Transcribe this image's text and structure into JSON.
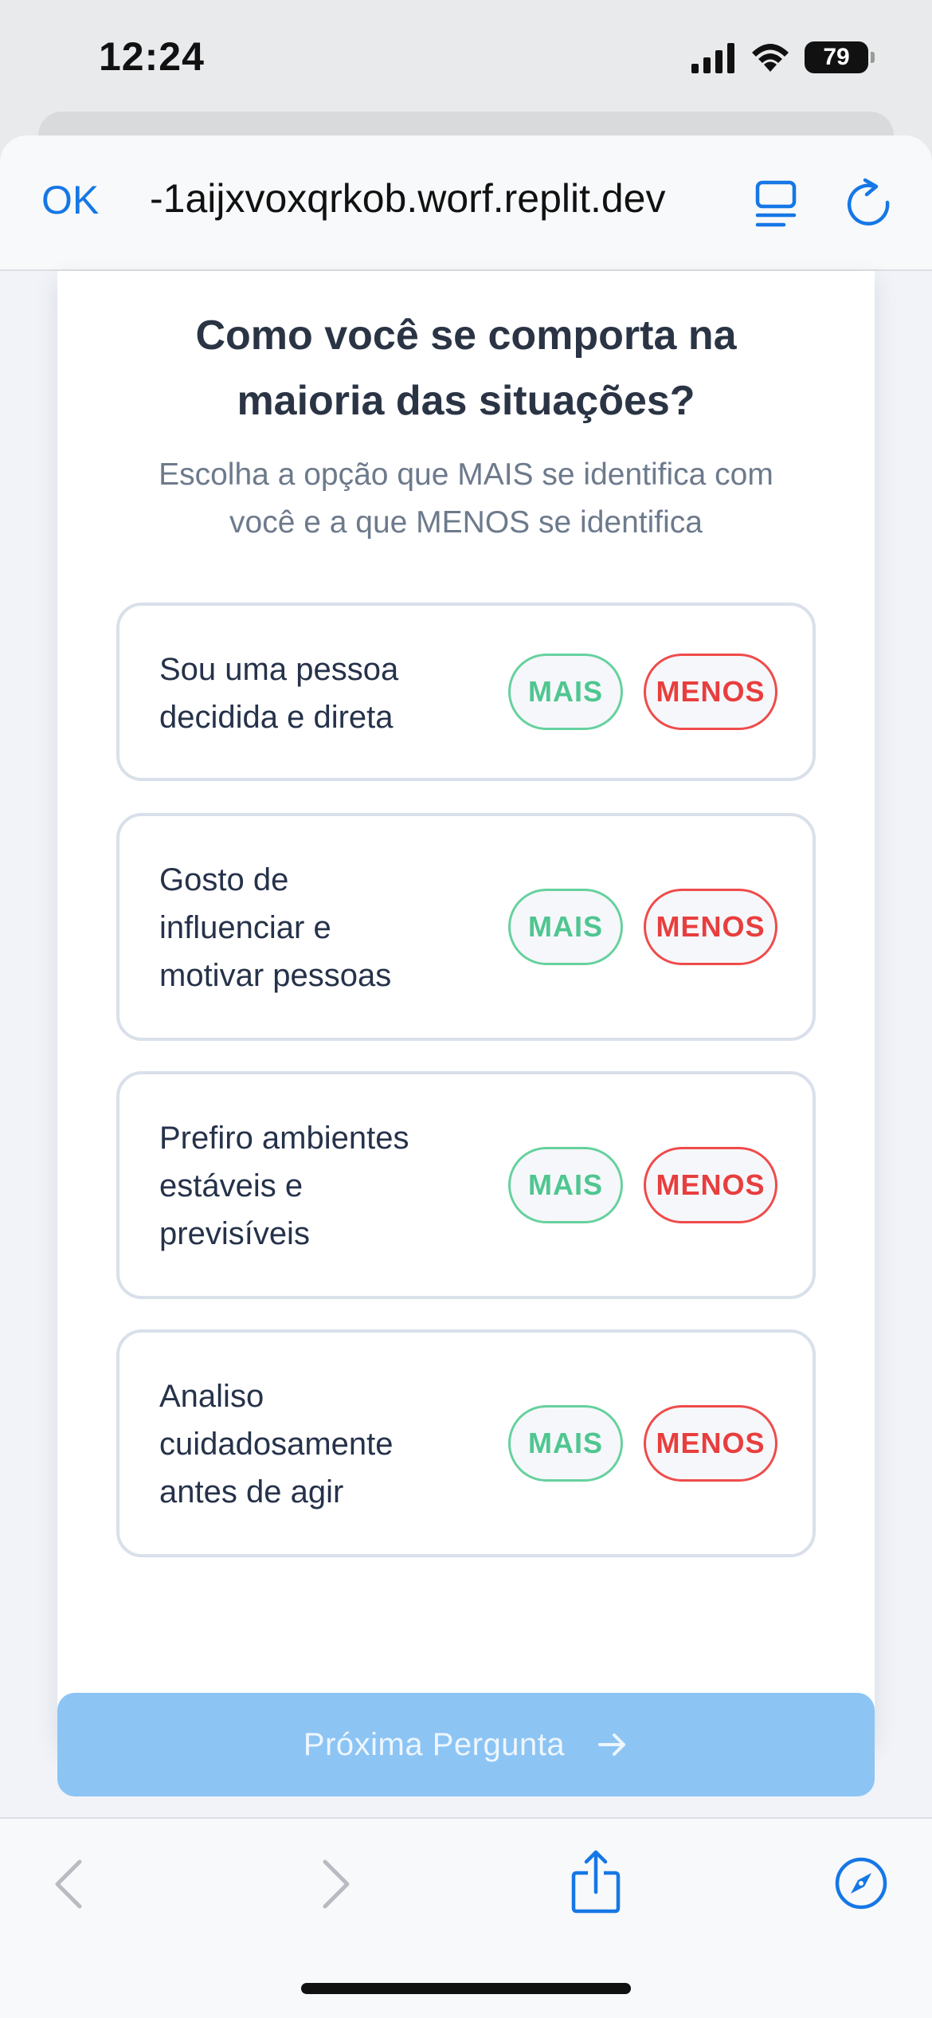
{
  "status_bar": {
    "time": "12:24",
    "battery": "79",
    "icons": [
      "signal-icon",
      "wifi-icon",
      "battery-icon"
    ]
  },
  "browser": {
    "done_label": "OK",
    "url": "-1aijxvoxqrkob.worf.replit.dev",
    "icons": [
      "reader-icon",
      "reload-icon"
    ]
  },
  "question": {
    "title_line1": "Como você se comporta na",
    "title_line2": "maioria das situações?",
    "subtitle_line1": "Escolha a opção que MAIS se identifica com",
    "subtitle_line2": "você e a que MENOS se identifica"
  },
  "options": [
    {
      "lines": [
        "Sou uma pessoa",
        "decidida e direta"
      ],
      "more_label": "MAIS",
      "less_label": "MENOS"
    },
    {
      "lines": [
        "Gosto de",
        "influenciar e",
        "motivar pessoas"
      ],
      "more_label": "MAIS",
      "less_label": "MENOS"
    },
    {
      "lines": [
        "Prefiro ambientes",
        "estáveis e",
        "previsíveis"
      ],
      "more_label": "MAIS",
      "less_label": "MENOS"
    },
    {
      "lines": [
        "Analiso",
        "cuidadosamente",
        "antes de agir"
      ],
      "more_label": "MAIS",
      "less_label": "MENOS"
    }
  ],
  "next_button": {
    "label": "Próxima Pergunta",
    "icon": "arrow-right-icon"
  },
  "toolbar": {
    "icons": [
      "back-icon",
      "forward-icon",
      "share-icon",
      "compass-icon"
    ]
  },
  "colors": {
    "accent": "#1677e6",
    "mais": "#4fc690",
    "menos": "#e83e3e",
    "next_button": "#8cc4f4"
  }
}
